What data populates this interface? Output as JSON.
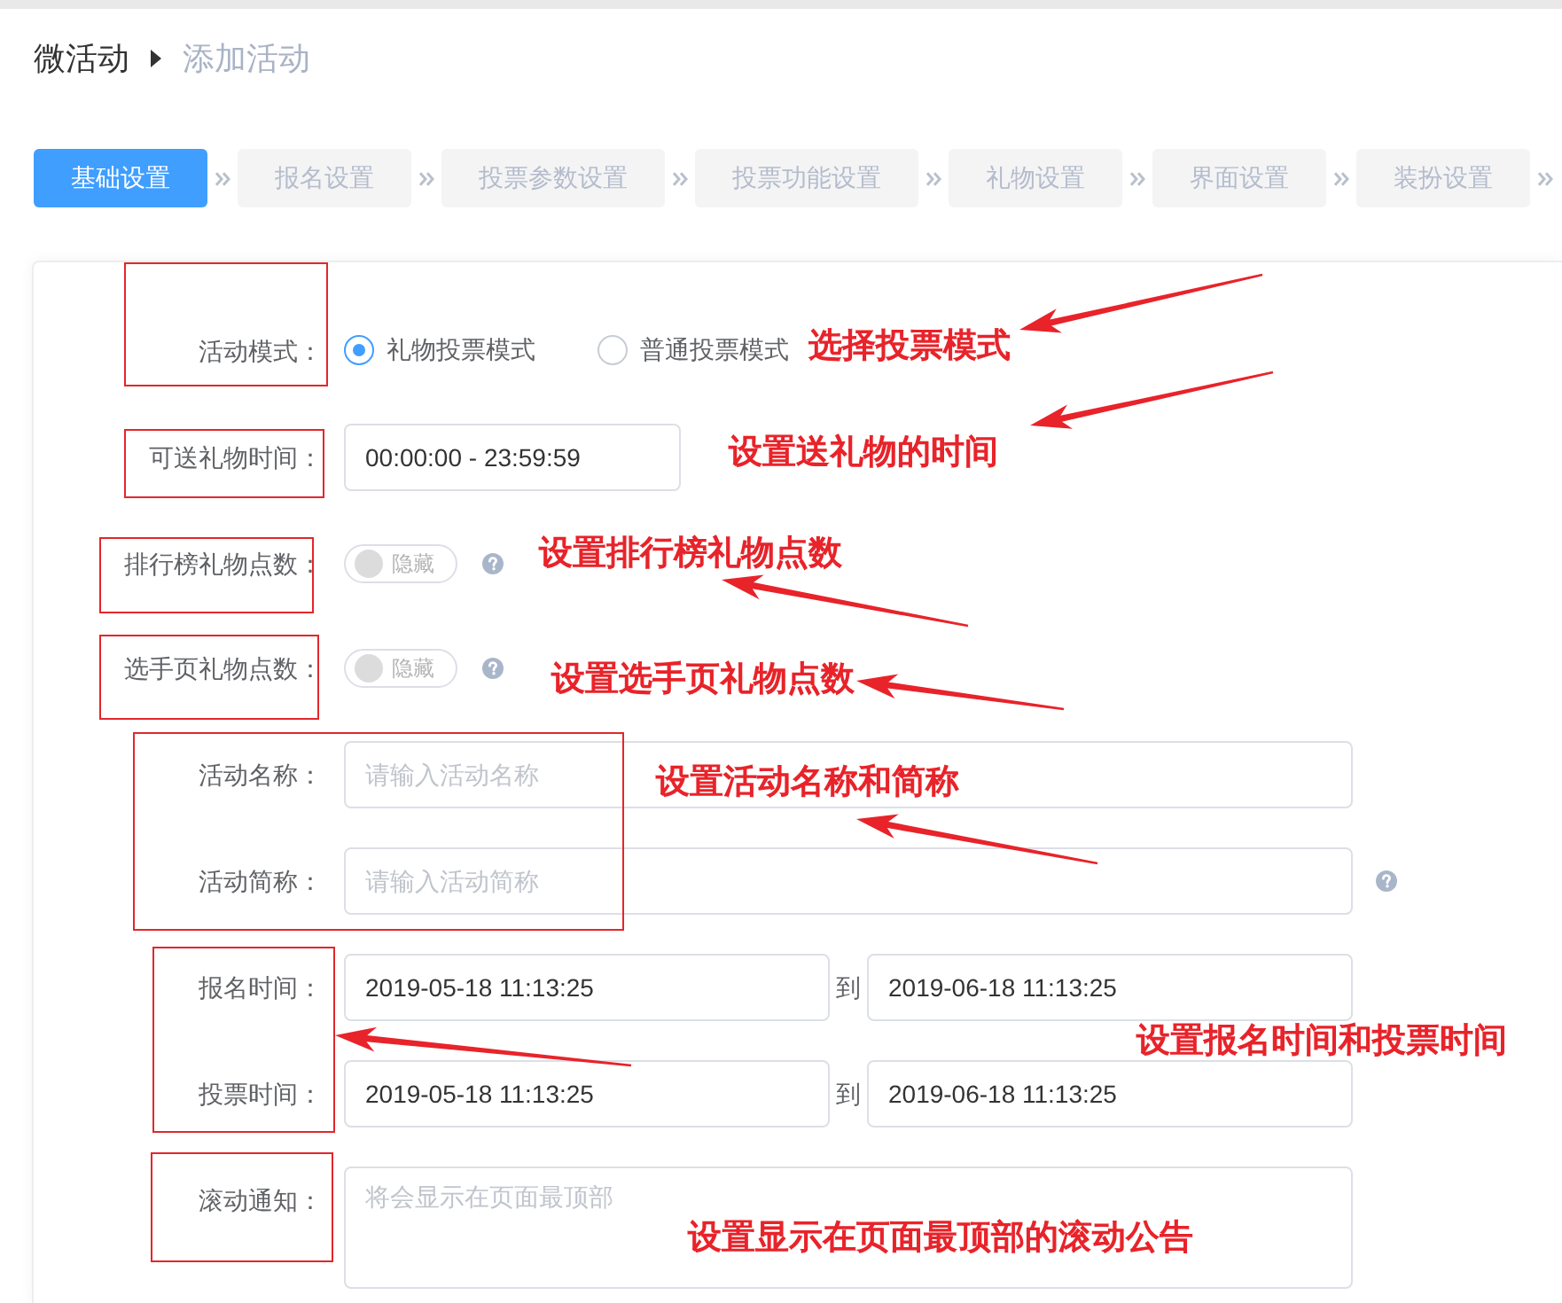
{
  "breadcrumb": [
    {
      "label": "微活动"
    },
    {
      "label": "添加活动"
    }
  ],
  "steps": [
    {
      "label": "基础设置",
      "selected": true
    },
    {
      "label": "报名设置",
      "selected": false
    },
    {
      "label": "投票参数设置",
      "selected": false
    },
    {
      "label": "投票功能设置",
      "selected": false
    },
    {
      "label": "礼物设置",
      "selected": false
    },
    {
      "label": "界面设置",
      "selected": false
    },
    {
      "label": "装扮设置",
      "selected": false
    }
  ],
  "form": {
    "rows": [
      {
        "kind": "radio",
        "label": "活动模式：",
        "options": [
          {
            "label": "礼物投票模式",
            "selected": true
          },
          {
            "label": "普通投票模式",
            "selected": false
          }
        ]
      },
      {
        "kind": "time",
        "label": "可送礼物时间：",
        "value": "00:00:00 - 23:59:59"
      },
      {
        "kind": "switch",
        "label": "排行榜礼物点数：",
        "on": false,
        "text": "隐藏",
        "help": true
      },
      {
        "kind": "switch",
        "label": "选手页礼物点数：",
        "on": false,
        "text": "隐藏",
        "help": true
      },
      {
        "kind": "text",
        "label": "活动名称：",
        "placeholder": "请输入活动名称"
      },
      {
        "kind": "text",
        "label": "活动简称：",
        "placeholder": "请输入活动简称",
        "help": true
      },
      {
        "kind": "range",
        "label": "报名时间：",
        "start": "2019-05-18 11:13:25",
        "separator": "到",
        "end": "2019-06-18 11:13:25"
      },
      {
        "kind": "range",
        "label": "投票时间：",
        "start": "2019-05-18 11:13:25",
        "separator": "到",
        "end": "2019-06-18 11:13:25"
      },
      {
        "kind": "textarea",
        "label": "滚动通知：",
        "placeholder": "将会显示在页面最顶部"
      }
    ]
  },
  "annotations": [
    {
      "text": "选择投票模式"
    },
    {
      "text": "设置送礼物的时间"
    },
    {
      "text": "设置排行榜礼物点数"
    },
    {
      "text": "设置选手页礼物点数"
    },
    {
      "text": "设置活动名称和简称"
    },
    {
      "text": "设置报名时间和投票时间"
    },
    {
      "text": "设置显示在页面最顶部的滚动公告"
    }
  ]
}
